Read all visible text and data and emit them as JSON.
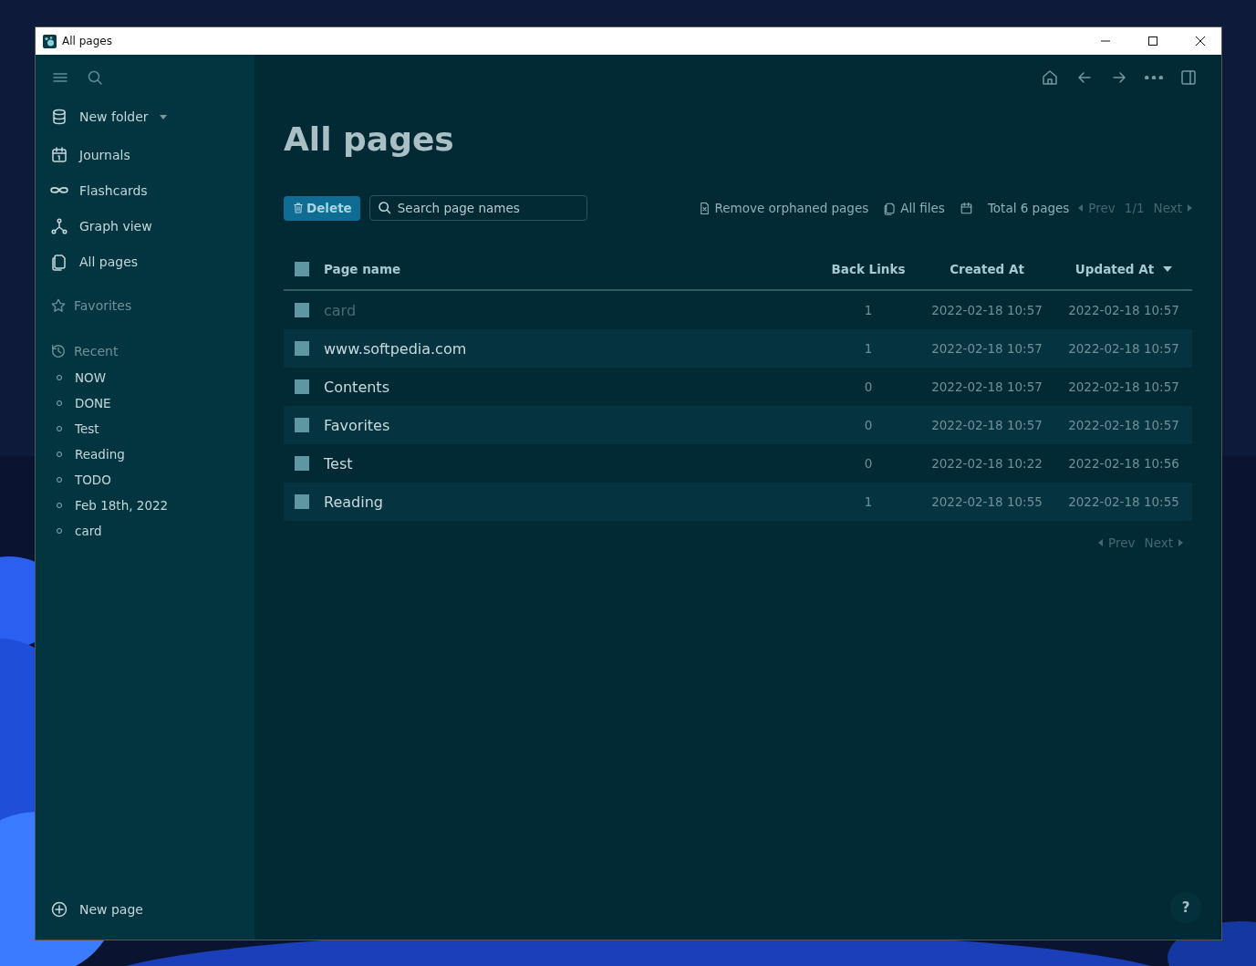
{
  "window": {
    "title": "All pages"
  },
  "sidebar": {
    "workspace": "New folder",
    "nav": [
      {
        "label": "Journals"
      },
      {
        "label": "Flashcards"
      },
      {
        "label": "Graph view"
      },
      {
        "label": "All pages"
      }
    ],
    "favorites": "Favorites",
    "recent": "Recent",
    "recent_items": [
      "NOW",
      "DONE",
      "Test",
      "Reading",
      "TODO",
      "Feb 18th, 2022",
      "card"
    ],
    "new_page": "New page"
  },
  "main": {
    "title": "All pages",
    "delete_button": "Delete",
    "search": {
      "placeholder": "Search page names"
    },
    "remove_orphaned": "Remove orphaned pages",
    "all_files": "All files",
    "total": "Total 6 pages",
    "pager_top": {
      "prev": "Prev",
      "page": "1/1",
      "next": "Next"
    },
    "table": {
      "select_all_checked": false,
      "columns": [
        "Page name",
        "Back Links",
        "Created At",
        "Updated At"
      ],
      "rows": [
        {
          "checked": false,
          "name": "card",
          "links": "1",
          "created": "2022-02-18 10:57",
          "updated": "2022-02-18 10:57",
          "dimmed": true
        },
        {
          "checked": false,
          "name": "www.softpedia.com",
          "links": "1",
          "created": "2022-02-18 10:57",
          "updated": "2022-02-18 10:57",
          "dimmed": false
        },
        {
          "checked": false,
          "name": "Contents",
          "links": "0",
          "created": "2022-02-18 10:57",
          "updated": "2022-02-18 10:57",
          "dimmed": false
        },
        {
          "checked": false,
          "name": "Favorites",
          "links": "0",
          "created": "2022-02-18 10:57",
          "updated": "2022-02-18 10:57",
          "dimmed": false
        },
        {
          "checked": false,
          "name": "Test",
          "links": "0",
          "created": "2022-02-18 10:22",
          "updated": "2022-02-18 10:56",
          "dimmed": false
        },
        {
          "checked": false,
          "name": "Reading",
          "links": "1",
          "created": "2022-02-18 10:55",
          "updated": "2022-02-18 10:55",
          "dimmed": false
        }
      ]
    },
    "pager_bottom": {
      "prev": "Prev",
      "next": "Next"
    },
    "help": "?"
  }
}
